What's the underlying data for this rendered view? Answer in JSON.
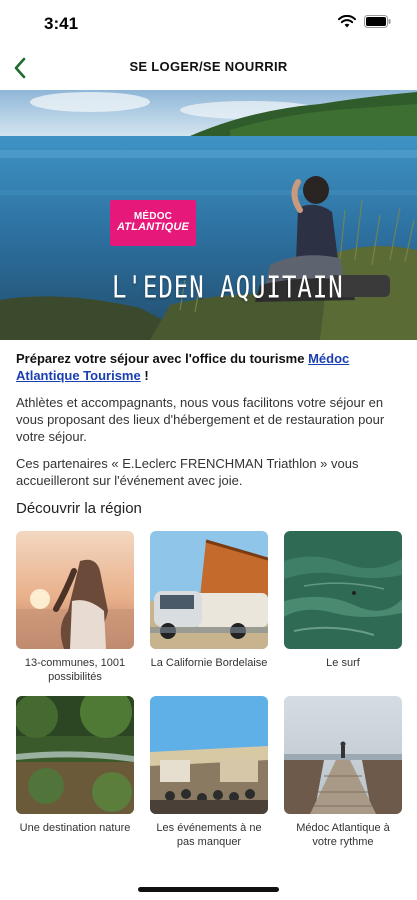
{
  "status_bar": {
    "time": "3:41"
  },
  "nav": {
    "title": "SE LOGER/SE NOURRIR"
  },
  "hero": {
    "logo_line1": "MÉDOC",
    "logo_line2": "ATLANTIQUE",
    "tagline": "L'EDEN AQUITAIN"
  },
  "intro": {
    "text_before": "Préparez votre séjour avec l'office du tourisme ",
    "link_text": "Médoc Atlantique Tourisme",
    "text_after": " !"
  },
  "paragraphs": {
    "p1": "Athlètes et accompagnants, nous vous facilitons votre séjour en vous proposant des lieux d'hébergement et de restauration pour votre séjour.",
    "p2": "Ces partenaires « E.Leclerc FRENCHMAN Triathlon » vous accueilleront sur l'événement avec joie."
  },
  "section": {
    "title": "Découvrir la région"
  },
  "tiles": [
    {
      "label": "13-communes, 1001 possibilités"
    },
    {
      "label": "La Californie Bordelaise"
    },
    {
      "label": "Le surf"
    },
    {
      "label": "Une destination nature"
    },
    {
      "label": "Les événements à ne pas manquer"
    },
    {
      "label": "Médoc Atlantique à votre rythme"
    }
  ],
  "colors": {
    "accent": "#1f6b2e",
    "link": "#1a3fb0",
    "logo_pink": "#e6197a"
  }
}
